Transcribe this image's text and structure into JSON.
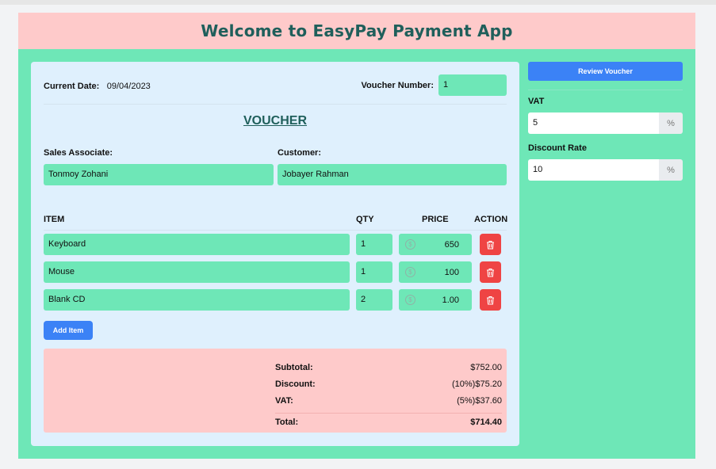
{
  "header": {
    "title": "Welcome to EasyPay Payment App"
  },
  "voucher": {
    "current_date_label": "Current Date:",
    "current_date": "09/04/2023",
    "voucher_number_label": "Voucher Number:",
    "voucher_number": "1",
    "title": "VOUCHER",
    "sales_associate_label": "Sales Associate:",
    "sales_associate": "Tonmoy Zohani",
    "customer_label": "Customer:",
    "customer": "Jobayer Rahman"
  },
  "table": {
    "headers": {
      "item": "ITEM",
      "qty": "QTY",
      "price": "PRICE",
      "action": "ACTION"
    },
    "rows": [
      {
        "item": "Keyboard",
        "qty": "1",
        "price": "650"
      },
      {
        "item": "Mouse",
        "qty": "1",
        "price": "100"
      },
      {
        "item": "Blank CD",
        "qty": "2",
        "price": "1.00"
      }
    ],
    "currency_icon": "dollar-circle-icon",
    "delete_icon": "trash-icon"
  },
  "add_item_label": "Add Item",
  "summary": {
    "subtotal_label": "Subtotal:",
    "subtotal": "$752.00",
    "discount_label": "Discount:",
    "discount": "(10%)$75.20",
    "vat_label": "VAT:",
    "vat": "(5%)$37.60",
    "total_label": "Total:",
    "total": "$714.40"
  },
  "sidebar": {
    "review_label": "Review Voucher",
    "vat_label": "VAT",
    "vat_value": "5",
    "discount_label": "Discount Rate",
    "discount_value": "10",
    "percent_suffix": "%"
  },
  "colors": {
    "app_bg": "#6ee7b7",
    "header_bg": "#fecaca",
    "card_bg": "#dff0fd",
    "accent_blue": "#3b82f6",
    "delete_red": "#ef4444",
    "title_teal": "#1f5f5b"
  }
}
